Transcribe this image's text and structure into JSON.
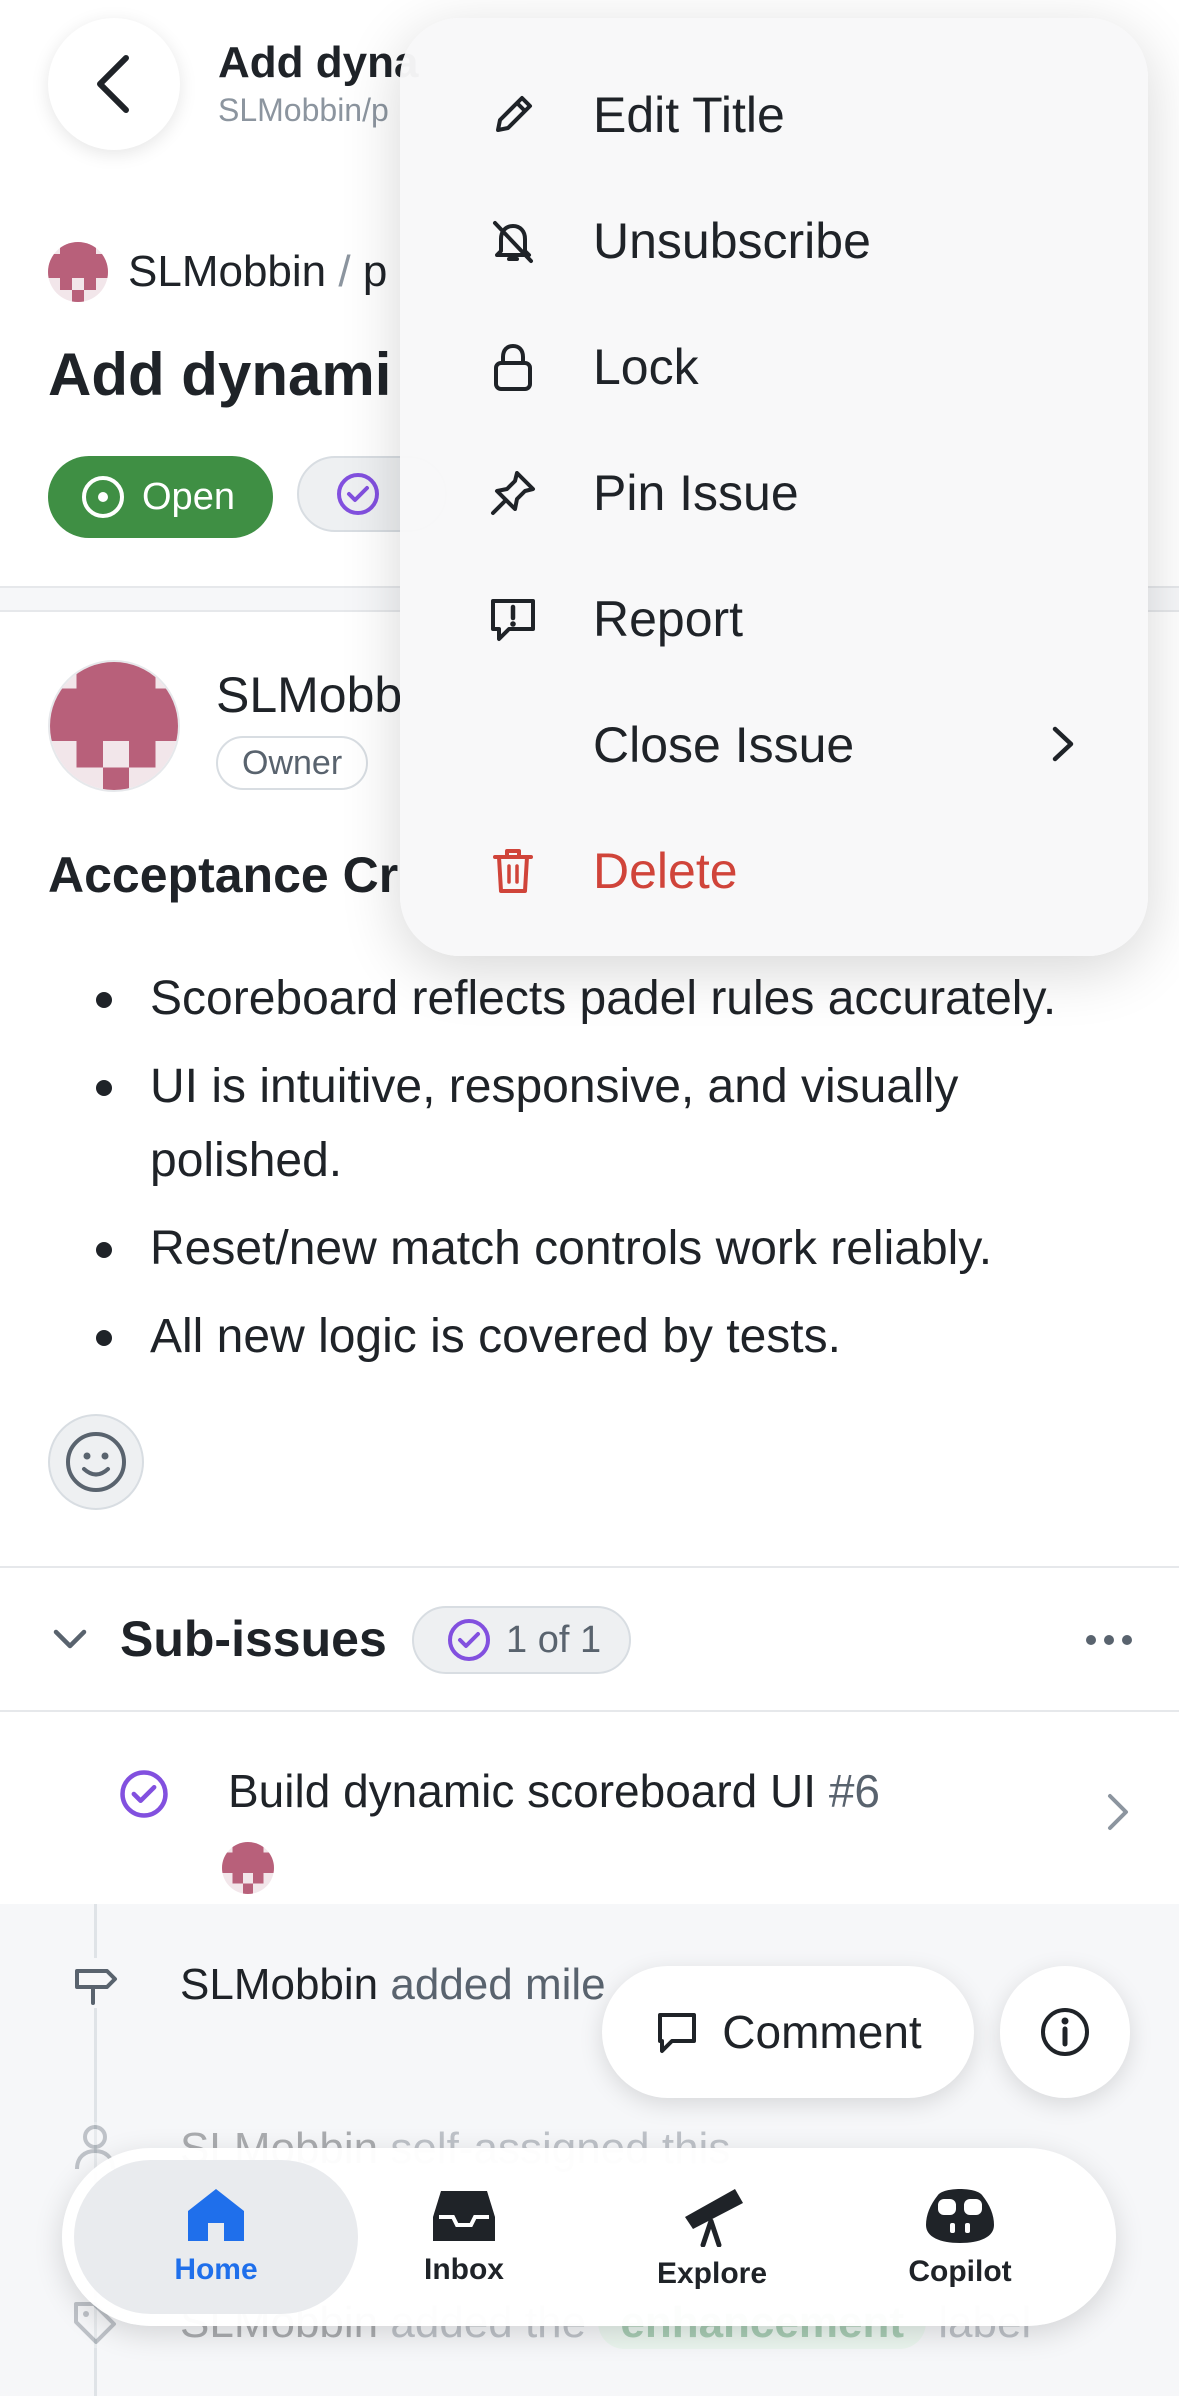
{
  "header": {
    "title": "Add dyna",
    "subtitle": "SLMobbin/p"
  },
  "repo": {
    "owner": "SLMobbin",
    "separator": "/",
    "name_fragment": "p"
  },
  "issue": {
    "title_fragment": "Add dynami",
    "status": "Open"
  },
  "comment": {
    "author_fragment": "SLMobb",
    "role": "Owner",
    "heading_fragment": "Acceptance Cr",
    "bullets": [
      "Scoreboard reflects padel rules accurately.",
      "UI is intuitive, responsive, and visually polished.",
      "Reset/new match controls work reliably.",
      "All new logic is covered by tests."
    ]
  },
  "subissues": {
    "title": "Sub-issues",
    "count": "1 of 1",
    "items": [
      {
        "title": "Build dynamic scoreboard UI",
        "number": "#6"
      }
    ]
  },
  "timeline": [
    {
      "actor": "SLMobbin",
      "text": "added mile",
      "icon": "milestone-icon"
    },
    {
      "actor": "SLMobbin",
      "text": "self-assigned this",
      "icon": "person-icon"
    },
    {
      "actor": "SLMobbin",
      "text": "added the",
      "extra": "enhancement",
      "extra2": "label",
      "icon": "tag-icon"
    }
  ],
  "actions": {
    "comment_label": "Comment"
  },
  "tabs": [
    {
      "label": "Home",
      "icon": "home-icon",
      "active": true
    },
    {
      "label": "Inbox",
      "icon": "inbox-icon",
      "active": false
    },
    {
      "label": "Explore",
      "icon": "telescope-icon",
      "active": false
    },
    {
      "label": "Copilot",
      "icon": "copilot-icon",
      "active": false
    }
  ],
  "menu": {
    "items": [
      {
        "label": "Edit Title",
        "icon": "pencil-icon"
      },
      {
        "label": "Unsubscribe",
        "icon": "bell-slash-icon"
      },
      {
        "label": "Lock",
        "icon": "lock-icon"
      },
      {
        "label": "Pin Issue",
        "icon": "pin-icon"
      },
      {
        "label": "Report",
        "icon": "report-icon"
      },
      {
        "label": "Close Issue",
        "icon": "chevron-right-icon"
      },
      {
        "label": "Delete",
        "icon": "trash-icon"
      }
    ]
  },
  "colors": {
    "open_green": "#3f8f44",
    "accent_blue": "#1f6feb",
    "done_purple": "#8250df",
    "danger_red": "#d0443a",
    "avatar_pink": "#b8607a"
  }
}
